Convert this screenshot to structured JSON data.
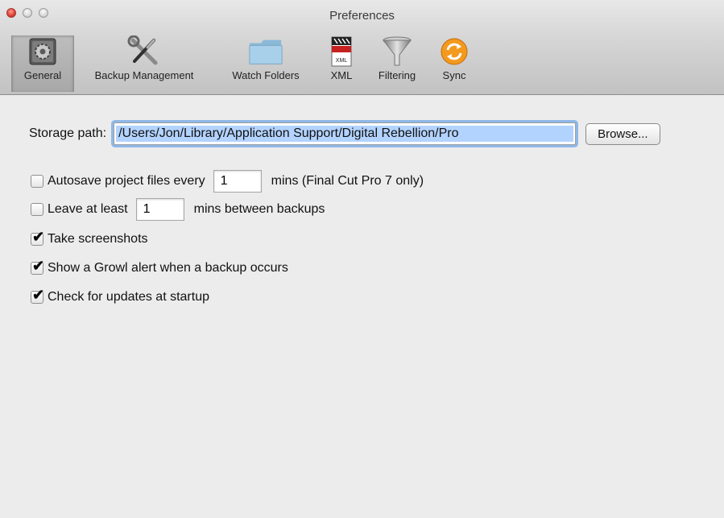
{
  "window": {
    "title": "Preferences"
  },
  "toolbar": {
    "items": [
      {
        "label": "General",
        "icon": "gear-icon",
        "selected": true
      },
      {
        "label": "Backup Management",
        "icon": "tools-icon",
        "selected": false
      },
      {
        "label": "Watch Folders",
        "icon": "folder-icon",
        "selected": false
      },
      {
        "label": "XML",
        "icon": "xml-file-icon",
        "selected": false
      },
      {
        "label": "Filtering",
        "icon": "funnel-icon",
        "selected": false
      },
      {
        "label": "Sync",
        "icon": "sync-icon",
        "selected": false
      }
    ]
  },
  "general": {
    "storage_label": "Storage path:",
    "storage_path": "/Users/Jon/Library/Application Support/Digital Rebellion/Pro",
    "browse_label": "Browse...",
    "autosave_label": "Autosave project files every",
    "autosave_value": "1",
    "autosave_suffix": "mins (Final Cut Pro 7 only)",
    "autosave_checked": false,
    "leave_label": "Leave at least",
    "leave_value": "1",
    "leave_suffix": "mins between backups",
    "leave_checked": false,
    "screenshots_label": "Take screenshots",
    "screenshots_checked": true,
    "growl_label": "Show a Growl alert when a backup occurs",
    "growl_checked": true,
    "updates_label": "Check for updates at startup",
    "updates_checked": true,
    "check_glyph": "✔"
  },
  "colors": {
    "selection": "#b3d3ff",
    "focus_ring": "#8fb8e8",
    "sync_orange": "#f39a1e"
  }
}
